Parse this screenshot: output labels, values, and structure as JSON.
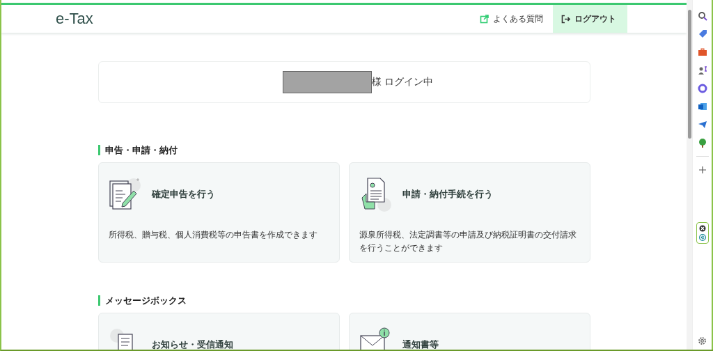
{
  "header": {
    "logo": "e-Tax",
    "links": [
      {
        "kind": "external",
        "label": "よくある質問"
      },
      {
        "kind": "logout",
        "label": "ログアウト"
      }
    ]
  },
  "login_status": {
    "name_redacted": true,
    "text": "様 ログイン中"
  },
  "sections": [
    {
      "title": "申告・申請・納付",
      "cards": [
        {
          "title": "確定申告を行う",
          "description": "所得税、贈与税、個人消費税等の申告書を作成できます"
        },
        {
          "title": "申請・納付手続を行う",
          "description": "源泉所得税、法定調書等の申請及び納税証明書の交付請求を行うことができます"
        }
      ]
    },
    {
      "title": "メッセージボックス",
      "cards": [
        {
          "title": "お知らせ・受信通知"
        },
        {
          "title": "通知書等"
        }
      ]
    }
  ]
}
